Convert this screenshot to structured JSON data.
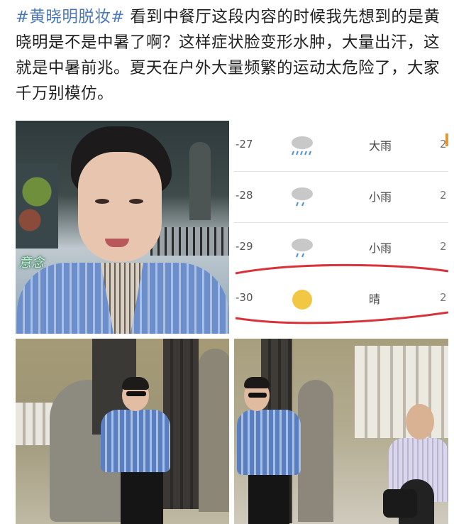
{
  "post": {
    "hashtag": "#黄晓明脱妆#",
    "body": " 看到中餐厅这段内容的时候我先想到的是黄晓明是不是中暑了啊？这样症状脸变形水肿，大量出汗，这就是中暑前兆。夏天在户外大量频繁的运动太危险了，大家千万别模仿。"
  },
  "photo1": {
    "watermark": "意念"
  },
  "weather": {
    "rows": [
      {
        "date": "-27",
        "icon": "heavy-rain-icon",
        "condition": "大雨",
        "temp": "2"
      },
      {
        "date": "-28",
        "icon": "light-rain-icon",
        "condition": "小雨",
        "temp": "2"
      },
      {
        "date": "-29",
        "icon": "light-rain-icon",
        "condition": "小雨",
        "temp": "2"
      },
      {
        "date": "-30",
        "icon": "sun-icon",
        "condition": "晴",
        "temp": "2"
      }
    ],
    "colors": {
      "highlight": "#d8333a",
      "sun": "#f2c744",
      "cloud": "#c8c8c8",
      "rain": "#4a90d9"
    }
  }
}
